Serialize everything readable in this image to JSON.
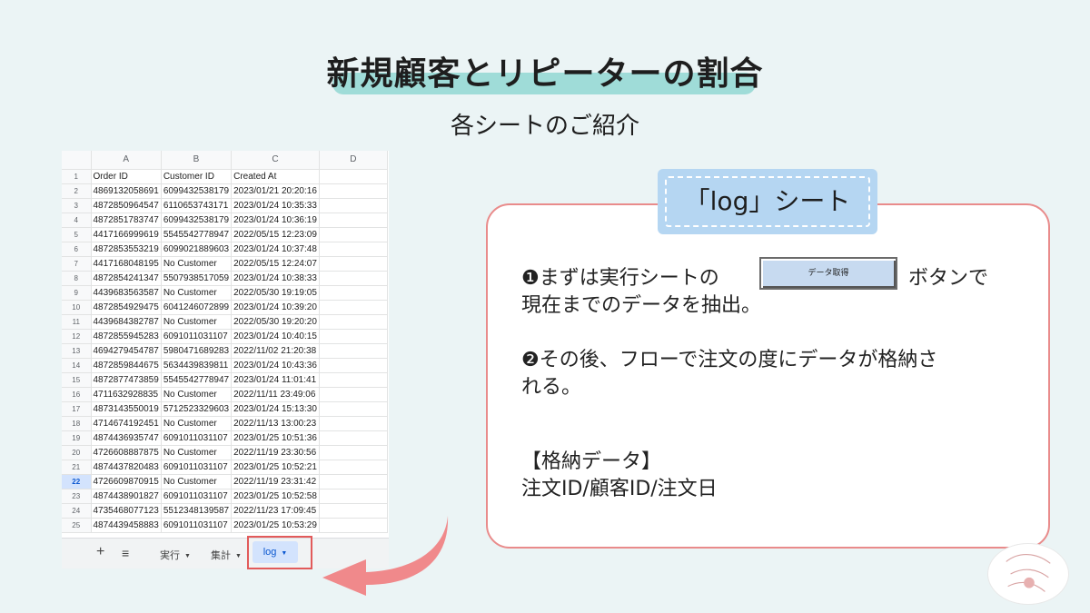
{
  "title": "新規顧客とリピーターの割合",
  "subtitle": "各シートのご紹介",
  "sheet": {
    "col_letters": [
      "A",
      "B",
      "C",
      "D"
    ],
    "header_row_number": "1",
    "headers": [
      "Order ID",
      "Customer ID",
      "Created At",
      ""
    ],
    "active_row": "22",
    "rows": [
      {
        "n": "2",
        "a": "4869132058691",
        "b": "6099432538179",
        "c": "2023/01/21 20:20:16"
      },
      {
        "n": "3",
        "a": "4872850964547",
        "b": "6110653743171",
        "c": "2023/01/24 10:35:33"
      },
      {
        "n": "4",
        "a": "4872851783747",
        "b": "6099432538179",
        "c": "2023/01/24 10:36:19"
      },
      {
        "n": "5",
        "a": "4417166999619",
        "b": "5545542778947",
        "c": "2022/05/15 12:23:09"
      },
      {
        "n": "6",
        "a": "4872853553219",
        "b": "6099021889603",
        "c": "2023/01/24 10:37:48"
      },
      {
        "n": "7",
        "a": "4417168048195",
        "b": "No Customer",
        "c": "2022/05/15 12:24:07"
      },
      {
        "n": "8",
        "a": "4872854241347",
        "b": "5507938517059",
        "c": "2023/01/24 10:38:33"
      },
      {
        "n": "9",
        "a": "4439683563587",
        "b": "No Customer",
        "c": "2022/05/30 19:19:05"
      },
      {
        "n": "10",
        "a": "4872854929475",
        "b": "6041246072899",
        "c": "2023/01/24 10:39:20"
      },
      {
        "n": "11",
        "a": "4439684382787",
        "b": "No Customer",
        "c": "2022/05/30 19:20:20"
      },
      {
        "n": "12",
        "a": "4872855945283",
        "b": "6091011031107",
        "c": "2023/01/24 10:40:15"
      },
      {
        "n": "13",
        "a": "4694279454787",
        "b": "5980471689283",
        "c": "2022/11/02 21:20:38"
      },
      {
        "n": "14",
        "a": "4872859844675",
        "b": "5634439839811",
        "c": "2023/01/24 10:43:36"
      },
      {
        "n": "15",
        "a": "4872877473859",
        "b": "5545542778947",
        "c": "2023/01/24 11:01:41"
      },
      {
        "n": "16",
        "a": "4711632928835",
        "b": "No Customer",
        "c": "2022/11/11 23:49:06"
      },
      {
        "n": "17",
        "a": "4873143550019",
        "b": "5712523329603",
        "c": "2023/01/24 15:13:30"
      },
      {
        "n": "18",
        "a": "4714674192451",
        "b": "No Customer",
        "c": "2022/11/13 13:00:23"
      },
      {
        "n": "19",
        "a": "4874436935747",
        "b": "6091011031107",
        "c": "2023/01/25 10:51:36"
      },
      {
        "n": "20",
        "a": "4726608887875",
        "b": "No Customer",
        "c": "2022/11/19 23:30:56"
      },
      {
        "n": "21",
        "a": "4874437820483",
        "b": "6091011031107",
        "c": "2023/01/25 10:52:21"
      },
      {
        "n": "22",
        "a": "4726609870915",
        "b": "No Customer",
        "c": "2022/11/19 23:31:42"
      },
      {
        "n": "23",
        "a": "4874438901827",
        "b": "6091011031107",
        "c": "2023/01/25 10:52:58"
      },
      {
        "n": "24",
        "a": "4735468077123",
        "b": "5512348139587",
        "c": "2022/11/23 17:09:45"
      },
      {
        "n": "25",
        "a": "4874439458883",
        "b": "6091011031107",
        "c": "2023/01/25 10:53:29"
      }
    ]
  },
  "tabs": {
    "plus": "+",
    "menu": "≡",
    "items": [
      {
        "label": "実行"
      },
      {
        "label": "集計"
      },
      {
        "label": "log"
      }
    ],
    "caret": "▼"
  },
  "card": {
    "badge": "「log」シート",
    "line1_pre": "❶まずは実行シートの",
    "line1_post": "ボタンで",
    "line2": "現在までのデータを抽出。",
    "button_label": "データ取得",
    "line3": "❷その後、フローで注文の度にデータが格納さ",
    "line4": "れる。",
    "stored_heading": "【格納データ】",
    "stored_items": "注文ID/顧客ID/注文日"
  },
  "colors": {
    "background": "#ebf4f5",
    "title_highlight": "#9fdcd8",
    "card_border": "#e98b8b",
    "badge_bg": "#b5d6f2",
    "arrow": "#f0898b",
    "tab_highlight": "#e25a5a"
  }
}
